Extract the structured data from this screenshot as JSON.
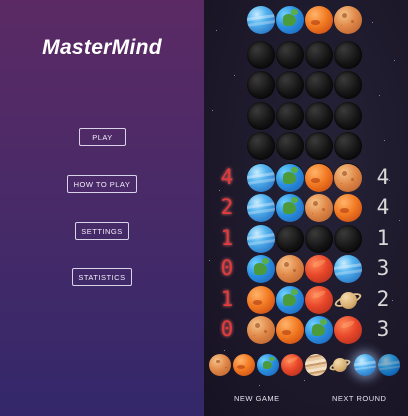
{
  "app": {
    "title": "MasterMind"
  },
  "menu": {
    "play": "PLAY",
    "how_to_play": "HOW TO PLAY",
    "settings": "SETTINGS",
    "statistics": "STATISTICS"
  },
  "footer": {
    "new_game": "NEW GAME",
    "next_round": "NEXT ROUND"
  },
  "secret_code": [
    "neptune",
    "earth",
    "mars",
    "venus"
  ],
  "board": {
    "empty_rows": 5,
    "rows": [
      {
        "pegs": [
          "neptune",
          "earth",
          "mars",
          "venus"
        ],
        "red": "4",
        "white": "4"
      },
      {
        "pegs": [
          "neptune",
          "earth",
          "venus",
          "mars"
        ],
        "red": "2",
        "white": "4"
      },
      {
        "pegs": [
          "neptune",
          "empty",
          "empty",
          "empty"
        ],
        "red": "1",
        "white": "1"
      },
      {
        "pegs": [
          "earth",
          "venus",
          "red",
          "neptune"
        ],
        "red": "0",
        "white": "3"
      },
      {
        "pegs": [
          "mars",
          "earth",
          "red",
          "saturn"
        ],
        "red": "1",
        "white": "2"
      },
      {
        "pegs": [
          "venus",
          "mars",
          "earth",
          "red"
        ],
        "red": "0",
        "white": "3"
      }
    ]
  },
  "palette": [
    "venus",
    "mars",
    "earth",
    "red",
    "jupiter",
    "saturn",
    "neptune",
    "neptune-dark"
  ],
  "palette_selected": "neptune",
  "colors": {
    "peg_red": "#e23b3b",
    "peg_white": "#d9d9d9",
    "accent": "#5b2a64"
  }
}
